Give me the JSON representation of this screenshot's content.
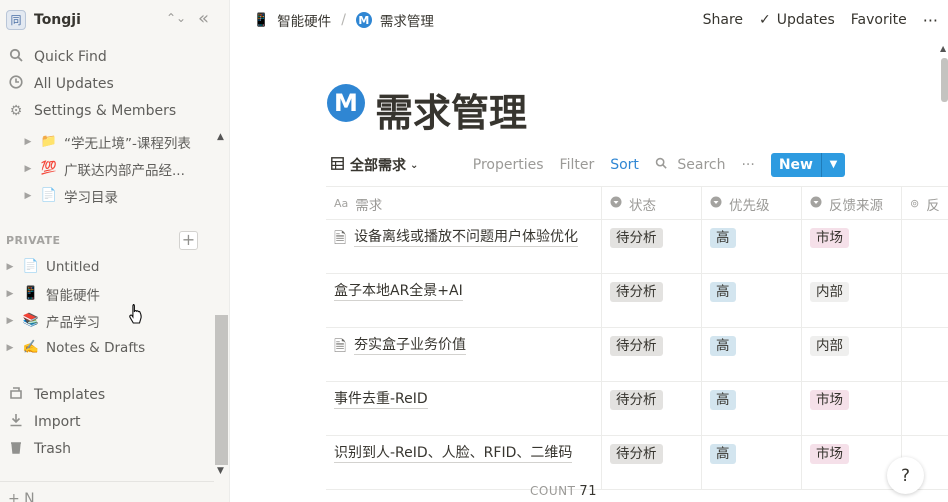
{
  "sidebar": {
    "workspace": {
      "name": "Tongji",
      "avatar": "同"
    },
    "nav": [
      {
        "label": "Quick Find",
        "icon": "search-icon"
      },
      {
        "label": "All Updates",
        "icon": "clock-icon"
      },
      {
        "label": "Settings & Members",
        "icon": "gear-icon"
      }
    ],
    "children": [
      {
        "label": "“学无止境”-课程列表",
        "icon": "📁"
      },
      {
        "label": "广联达内部产品经...",
        "icon": "💯"
      },
      {
        "label": "学习目录",
        "icon": "📄"
      }
    ],
    "section_label": "PRIVATE",
    "private": [
      {
        "label": "Untitled",
        "icon": "📄"
      },
      {
        "label": "智能硬件",
        "icon": "📱"
      },
      {
        "label": "产品学习",
        "icon": "📚"
      },
      {
        "label": "Notes & Drafts",
        "icon": "✍️"
      }
    ],
    "footer": [
      {
        "label": "Templates",
        "icon": "templates-icon"
      },
      {
        "label": "Import",
        "icon": "import-icon"
      },
      {
        "label": "Trash",
        "icon": "trash-icon"
      }
    ],
    "new_page": "+ N"
  },
  "topbar": {
    "breadcrumb": [
      {
        "label": "智能硬件",
        "icon": "📱"
      },
      {
        "label": "需求管理",
        "icon": "M"
      }
    ],
    "actions": {
      "share": "Share",
      "updates": "Updates",
      "favorite": "Favorite",
      "more": "···"
    }
  },
  "page": {
    "icon": "M",
    "title": "需求管理"
  },
  "view": {
    "name": "全部需求",
    "properties": "Properties",
    "filter": "Filter",
    "sort": "Sort",
    "search": "Search",
    "more": "···",
    "new": "New"
  },
  "table": {
    "headers": [
      {
        "label": "需求",
        "icon": "Aa"
      },
      {
        "label": "状态",
        "icon": "▾"
      },
      {
        "label": "优先级",
        "icon": "▾"
      },
      {
        "label": "反馈来源",
        "icon": "▾"
      },
      {
        "label": "反",
        "icon": "⊚"
      }
    ],
    "rows": [
      {
        "name": "设备离线或播放不问题用户体验优化",
        "has_doc": true,
        "status": "待分析",
        "priority": "高",
        "source": "市场"
      },
      {
        "name": "盒子本地AR全景+AI",
        "has_doc": false,
        "status": "待分析",
        "priority": "高",
        "source": "内部"
      },
      {
        "name": "夯实盒子业务价值",
        "has_doc": true,
        "status": "待分析",
        "priority": "高",
        "source": "内部"
      },
      {
        "name": "事件去重-ReID",
        "has_doc": false,
        "status": "待分析",
        "priority": "高",
        "source": "市场"
      },
      {
        "name": "识别到人-ReID、人脸、RFID、二维码",
        "has_doc": false,
        "status": "待分析",
        "priority": "高",
        "source": "市场"
      }
    ]
  },
  "footer": {
    "count_label": "COUNT",
    "count_value": "71"
  },
  "help": "?",
  "colors": {
    "accent": "#2e9be0",
    "sort": "#2f86d3",
    "tag_grey": "#e3e2e0",
    "tag_blue": "#d3e5ef",
    "tag_pink": "#f5e0e9"
  }
}
